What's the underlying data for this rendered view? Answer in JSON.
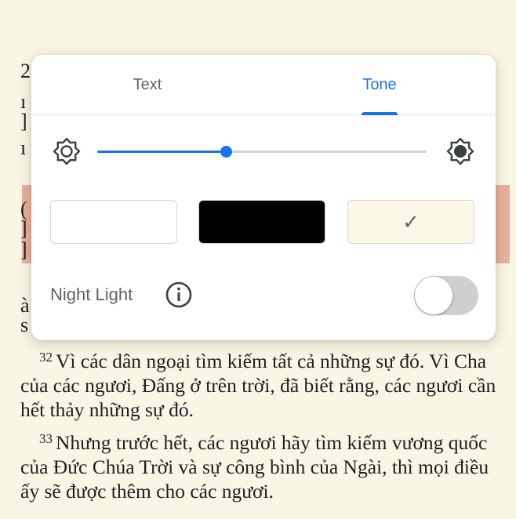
{
  "reader": {
    "peek_chars": [
      "2",
      "ı",
      "]",
      "ı",
      "(",
      "]",
      "]",
      "à",
      "s"
    ],
    "verses": [
      {
        "number": "32",
        "text": "Vì các dân ngoại tìm kiếm tất cả những sự đó. Vì Cha của các ngươi, Đấng ở trên trời, đã biết rằng, các ngươi cần hết thảy những sự đó."
      },
      {
        "number": "33",
        "text": "Nhưng trước hết, các ngươi hãy tìm kiếm vương quốc của Đức Chúa Trời và sự công bình của Ngài, thì mọi điều ấy sẽ được thêm cho các ngươi."
      }
    ]
  },
  "panel": {
    "tabs": [
      {
        "label": "Text",
        "active": false
      },
      {
        "label": "Tone",
        "active": true
      }
    ],
    "brightness": {
      "level": 0.39,
      "low_icon": "brightness-low-icon",
      "high_icon": "brightness-high-icon"
    },
    "swatches": [
      {
        "name": "white",
        "color": "#ffffff",
        "selected": false
      },
      {
        "name": "black",
        "color": "#000000",
        "selected": false
      },
      {
        "name": "sepia",
        "color": "#fbf8e8",
        "selected": true
      }
    ],
    "night_light": {
      "label": "Night Light",
      "enabled": false,
      "info_icon": "info-icon"
    }
  },
  "colors": {
    "accent": "#1a73e8",
    "page_bg": "#faf6e6",
    "highlight": "#e8b19b"
  }
}
